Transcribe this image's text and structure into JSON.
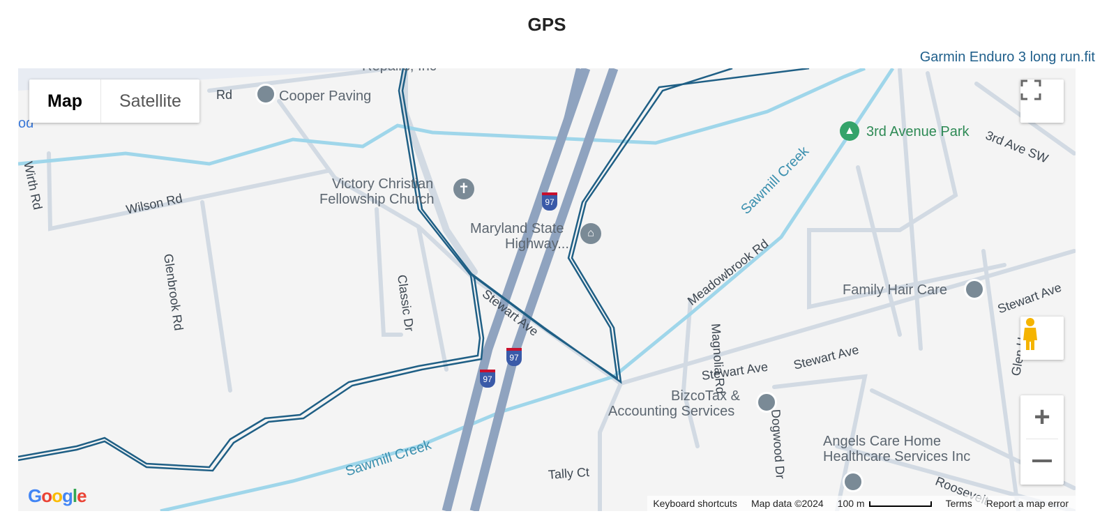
{
  "header": {
    "title": "GPS",
    "file_link": "Garmin Enduro 3 long run.fit"
  },
  "map": {
    "type_control": {
      "options": [
        "Map",
        "Satellite"
      ],
      "selected": "Map"
    },
    "labels": {
      "cooper_paving": "Cooper Paving",
      "repairs": "Repairs, Inc",
      "rd_partial": "Rd",
      "od_partial": "od",
      "wirth_rd": "Wirth Rd",
      "wilson_rd": "Wilson Rd",
      "glenbrook_rd": "Glenbrook Rd",
      "classic_dr": "Classic Dr",
      "victory_church_1": "Victory Christian",
      "victory_church_2": "Fellowship Church",
      "md_state_1": "Maryland State",
      "md_state_2": "Highway...",
      "stewart_ave_diag": "Stewart Ave",
      "stewart_ave_1": "Stewart Ave",
      "stewart_ave_2": "Stewart Ave",
      "stewart_ave_3": "Stewart Ave",
      "park": "3rd Avenue Park",
      "third_ave_sw": "3rd Ave SW",
      "sawmill_creek_1": "Sawmill Creek",
      "sawmill_creek_2": "Sawmill Creek",
      "meadowbrook_rd": "Meadowbrook Rd",
      "magnolia_rd": "Magnolia Rd",
      "dogwood_dr": "Dogwood Dr",
      "family_hair": "Family Hair Care",
      "bizco_1": "BizcoTax &",
      "bizco_2": "Accounting Services",
      "angels_1": "Angels Care Home",
      "angels_2": "Healthcare Services Inc",
      "tally_ct": "Tally Ct",
      "roosevelt": "Roosevelt",
      "glen_h": "Glen H",
      "i97": "97"
    },
    "footer": {
      "shortcuts": "Keyboard shortcuts",
      "map_data": "Map data ©2024",
      "scale": "100 m",
      "terms": "Terms",
      "report": "Report a map error"
    },
    "logo": "Google",
    "colors": {
      "track": "#1f5f85",
      "water": "#9fd6ea",
      "highway": "#8fa3bf",
      "road": "#cdd6e0",
      "poi": "#7a8a96",
      "park": "#34a36a"
    }
  }
}
